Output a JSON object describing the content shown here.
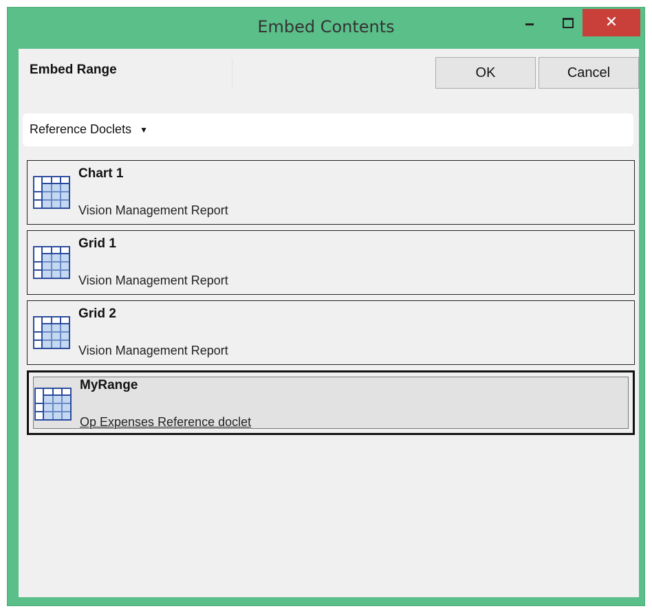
{
  "window": {
    "title": "Embed Contents",
    "titlebar_color": "#5bbf8a",
    "close_color": "#c9403b",
    "minimize_glyph": "",
    "close_glyph": "✕"
  },
  "header": {
    "title": "Embed Range",
    "ok_label": "OK",
    "cancel_label": "Cancel"
  },
  "filter": {
    "label": "Reference Doclets",
    "arrow": "▼"
  },
  "items": [
    {
      "title": "Chart 1",
      "subtitle": "Vision Management Report",
      "icon": "grid-icon",
      "selected": false
    },
    {
      "title": "Grid 1",
      "subtitle": "Vision Management Report",
      "icon": "grid-icon",
      "selected": false
    },
    {
      "title": "Grid 2",
      "subtitle": "Vision Management Report",
      "icon": "grid-icon",
      "selected": false
    },
    {
      "title": "MyRange",
      "subtitle": "Op Expenses Reference doclet",
      "icon": "grid-icon",
      "selected": true
    }
  ]
}
